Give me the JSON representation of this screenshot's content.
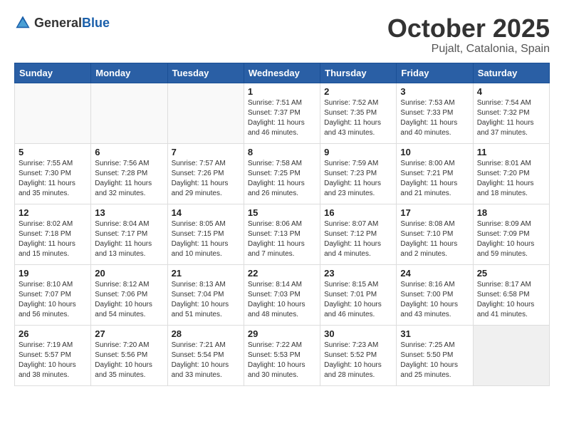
{
  "header": {
    "logo_general": "General",
    "logo_blue": "Blue",
    "month": "October 2025",
    "location": "Pujalt, Catalonia, Spain"
  },
  "weekdays": [
    "Sunday",
    "Monday",
    "Tuesday",
    "Wednesday",
    "Thursday",
    "Friday",
    "Saturday"
  ],
  "weeks": [
    [
      {
        "day": "",
        "info": "",
        "empty": true
      },
      {
        "day": "",
        "info": "",
        "empty": true
      },
      {
        "day": "",
        "info": "",
        "empty": true
      },
      {
        "day": "1",
        "info": "Sunrise: 7:51 AM\nSunset: 7:37 PM\nDaylight: 11 hours\nand 46 minutes.",
        "empty": false
      },
      {
        "day": "2",
        "info": "Sunrise: 7:52 AM\nSunset: 7:35 PM\nDaylight: 11 hours\nand 43 minutes.",
        "empty": false
      },
      {
        "day": "3",
        "info": "Sunrise: 7:53 AM\nSunset: 7:33 PM\nDaylight: 11 hours\nand 40 minutes.",
        "empty": false
      },
      {
        "day": "4",
        "info": "Sunrise: 7:54 AM\nSunset: 7:32 PM\nDaylight: 11 hours\nand 37 minutes.",
        "empty": false
      }
    ],
    [
      {
        "day": "5",
        "info": "Sunrise: 7:55 AM\nSunset: 7:30 PM\nDaylight: 11 hours\nand 35 minutes.",
        "empty": false
      },
      {
        "day": "6",
        "info": "Sunrise: 7:56 AM\nSunset: 7:28 PM\nDaylight: 11 hours\nand 32 minutes.",
        "empty": false
      },
      {
        "day": "7",
        "info": "Sunrise: 7:57 AM\nSunset: 7:26 PM\nDaylight: 11 hours\nand 29 minutes.",
        "empty": false
      },
      {
        "day": "8",
        "info": "Sunrise: 7:58 AM\nSunset: 7:25 PM\nDaylight: 11 hours\nand 26 minutes.",
        "empty": false
      },
      {
        "day": "9",
        "info": "Sunrise: 7:59 AM\nSunset: 7:23 PM\nDaylight: 11 hours\nand 23 minutes.",
        "empty": false
      },
      {
        "day": "10",
        "info": "Sunrise: 8:00 AM\nSunset: 7:21 PM\nDaylight: 11 hours\nand 21 minutes.",
        "empty": false
      },
      {
        "day": "11",
        "info": "Sunrise: 8:01 AM\nSunset: 7:20 PM\nDaylight: 11 hours\nand 18 minutes.",
        "empty": false
      }
    ],
    [
      {
        "day": "12",
        "info": "Sunrise: 8:02 AM\nSunset: 7:18 PM\nDaylight: 11 hours\nand 15 minutes.",
        "empty": false
      },
      {
        "day": "13",
        "info": "Sunrise: 8:04 AM\nSunset: 7:17 PM\nDaylight: 11 hours\nand 13 minutes.",
        "empty": false
      },
      {
        "day": "14",
        "info": "Sunrise: 8:05 AM\nSunset: 7:15 PM\nDaylight: 11 hours\nand 10 minutes.",
        "empty": false
      },
      {
        "day": "15",
        "info": "Sunrise: 8:06 AM\nSunset: 7:13 PM\nDaylight: 11 hours\nand 7 minutes.",
        "empty": false
      },
      {
        "day": "16",
        "info": "Sunrise: 8:07 AM\nSunset: 7:12 PM\nDaylight: 11 hours\nand 4 minutes.",
        "empty": false
      },
      {
        "day": "17",
        "info": "Sunrise: 8:08 AM\nSunset: 7:10 PM\nDaylight: 11 hours\nand 2 minutes.",
        "empty": false
      },
      {
        "day": "18",
        "info": "Sunrise: 8:09 AM\nSunset: 7:09 PM\nDaylight: 10 hours\nand 59 minutes.",
        "empty": false
      }
    ],
    [
      {
        "day": "19",
        "info": "Sunrise: 8:10 AM\nSunset: 7:07 PM\nDaylight: 10 hours\nand 56 minutes.",
        "empty": false
      },
      {
        "day": "20",
        "info": "Sunrise: 8:12 AM\nSunset: 7:06 PM\nDaylight: 10 hours\nand 54 minutes.",
        "empty": false
      },
      {
        "day": "21",
        "info": "Sunrise: 8:13 AM\nSunset: 7:04 PM\nDaylight: 10 hours\nand 51 minutes.",
        "empty": false
      },
      {
        "day": "22",
        "info": "Sunrise: 8:14 AM\nSunset: 7:03 PM\nDaylight: 10 hours\nand 48 minutes.",
        "empty": false
      },
      {
        "day": "23",
        "info": "Sunrise: 8:15 AM\nSunset: 7:01 PM\nDaylight: 10 hours\nand 46 minutes.",
        "empty": false
      },
      {
        "day": "24",
        "info": "Sunrise: 8:16 AM\nSunset: 7:00 PM\nDaylight: 10 hours\nand 43 minutes.",
        "empty": false
      },
      {
        "day": "25",
        "info": "Sunrise: 8:17 AM\nSunset: 6:58 PM\nDaylight: 10 hours\nand 41 minutes.",
        "empty": false
      }
    ],
    [
      {
        "day": "26",
        "info": "Sunrise: 7:19 AM\nSunset: 5:57 PM\nDaylight: 10 hours\nand 38 minutes.",
        "empty": false
      },
      {
        "day": "27",
        "info": "Sunrise: 7:20 AM\nSunset: 5:56 PM\nDaylight: 10 hours\nand 35 minutes.",
        "empty": false
      },
      {
        "day": "28",
        "info": "Sunrise: 7:21 AM\nSunset: 5:54 PM\nDaylight: 10 hours\nand 33 minutes.",
        "empty": false
      },
      {
        "day": "29",
        "info": "Sunrise: 7:22 AM\nSunset: 5:53 PM\nDaylight: 10 hours\nand 30 minutes.",
        "empty": false
      },
      {
        "day": "30",
        "info": "Sunrise: 7:23 AM\nSunset: 5:52 PM\nDaylight: 10 hours\nand 28 minutes.",
        "empty": false
      },
      {
        "day": "31",
        "info": "Sunrise: 7:25 AM\nSunset: 5:50 PM\nDaylight: 10 hours\nand 25 minutes.",
        "empty": false
      },
      {
        "day": "",
        "info": "",
        "empty": true
      }
    ]
  ]
}
